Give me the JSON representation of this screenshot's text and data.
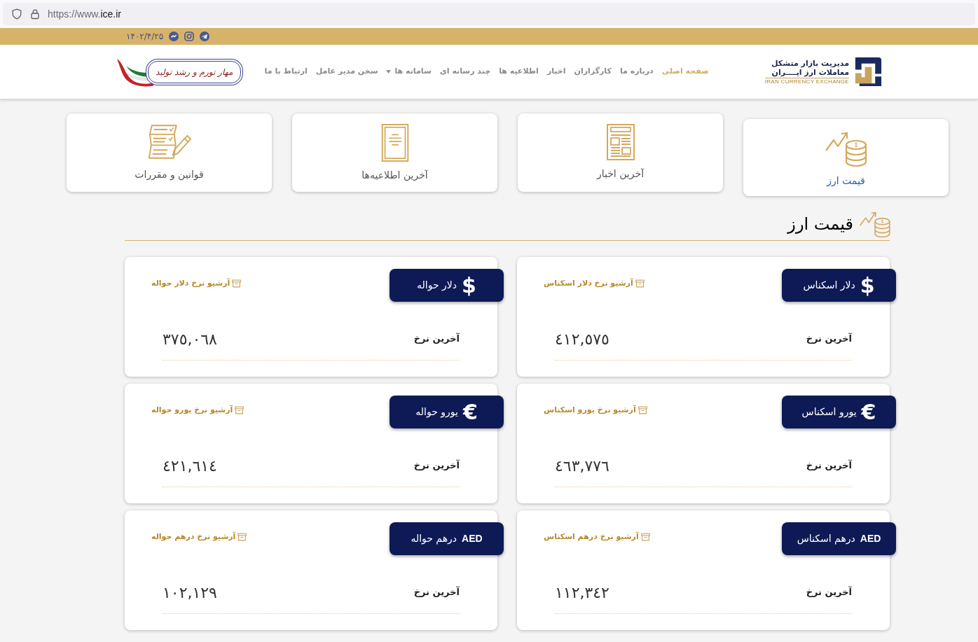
{
  "browser": {
    "url_prefix": "https://www.",
    "url_domain": "ice.ir"
  },
  "top_bar": {
    "date": "۱۴۰۲/۴/۲۵"
  },
  "header": {
    "logo": {
      "line_1": "مدیریت بازار متشکل",
      "line_2": "معاملات ارز ایــــران",
      "tagline": "IRAN CURRENCY EXCHANGE"
    },
    "nav": [
      {
        "label": "صفحه اصلی",
        "selected": true,
        "dropdown": false
      },
      {
        "label": "درباره ما",
        "selected": false,
        "dropdown": false
      },
      {
        "label": "کارگزاران",
        "selected": false,
        "dropdown": false
      },
      {
        "label": "اخبار",
        "selected": false,
        "dropdown": false
      },
      {
        "label": "اطلاعیه ها",
        "selected": false,
        "dropdown": false
      },
      {
        "label": "چند رسانه ای",
        "selected": false,
        "dropdown": false
      },
      {
        "label": "سامانه ها",
        "selected": false,
        "dropdown": true
      },
      {
        "label": "سخن مدیر عامل",
        "selected": false,
        "dropdown": false
      },
      {
        "label": "ارتباط با ما",
        "selected": false,
        "dropdown": false
      }
    ],
    "slogan": "مهار تورم و رشد تولید"
  },
  "tiles": [
    {
      "kind": "prices",
      "label": "قیمت ارز",
      "selected": true
    },
    {
      "kind": "news",
      "label": "آخرین اخبار",
      "selected": false
    },
    {
      "kind": "notices",
      "label": "آخرین اطلاعیه‌ها",
      "selected": false
    },
    {
      "kind": "rules",
      "label": "قوانین و مقررات",
      "selected": false
    }
  ],
  "section": {
    "title": "قیمت ارز"
  },
  "rates": [
    {
      "kind": "glyph",
      "symbol": "$",
      "name": "دلار اسکناس",
      "archive_link": "آرشیو نرخ دلار اسکناس",
      "rate_label": "آخرین نرخ",
      "value": "٤١٢,٥٧٥"
    },
    {
      "kind": "glyph",
      "symbol": "$",
      "name": "دلار حواله",
      "archive_link": "آرشیو نرخ دلار حواله",
      "rate_label": "آخرین نرخ",
      "value": "٣٧٥,٠٦٨"
    },
    {
      "kind": "glyph",
      "symbol": "€",
      "name": "یورو اسکناس",
      "archive_link": "آرشیو نرخ یورو اسکناس",
      "rate_label": "آخرین نرخ",
      "value": "٤٦٣,٧٧٦"
    },
    {
      "kind": "glyph",
      "symbol": "€",
      "name": "یورو حواله",
      "archive_link": "آرشیو نرخ یورو حواله",
      "rate_label": "آخرین نرخ",
      "value": "٤٢١,٦١٤"
    },
    {
      "kind": "code",
      "symbol": "AED",
      "name": "درهم اسکناس",
      "archive_link": "آرشیو نرخ درهم اسکناس",
      "rate_label": "آخرین نرخ",
      "value": "١١٢,٣٤٢"
    },
    {
      "kind": "code",
      "symbol": "AED",
      "name": "درهم حواله",
      "archive_link": "آرشیو نرخ درهم حواله",
      "rate_label": "آخرین نرخ",
      "value": "١٠٢,١٢٩"
    }
  ]
}
